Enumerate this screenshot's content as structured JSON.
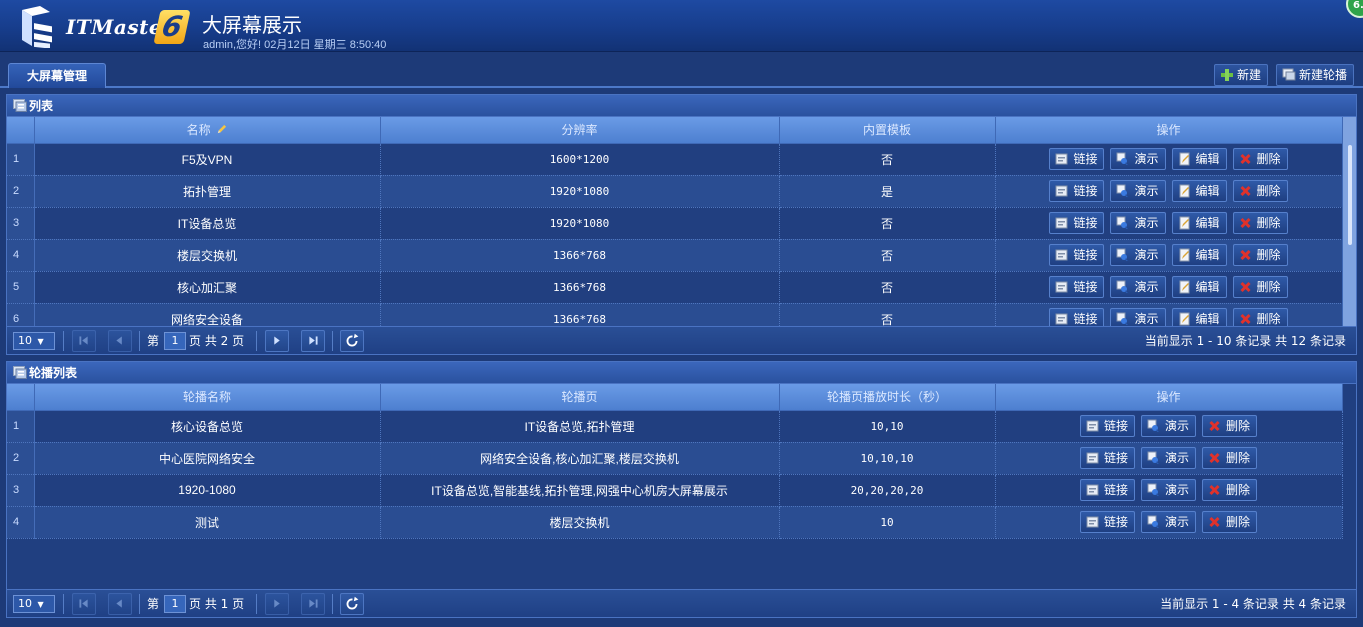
{
  "header": {
    "logo_text": "ITMaster",
    "logo_number": "6",
    "title": "大屏幕展示",
    "user_info": "admin,您好! 02月12日 星期三 8:50:40",
    "badge": "6."
  },
  "tabs": [
    {
      "label": "大屏幕管理"
    }
  ],
  "toolbar": {
    "new_label": "新建",
    "new_carousel_label": "新建轮播"
  },
  "list_panel": {
    "title": "列表",
    "columns": [
      "名称",
      "分辨率",
      "内置模板",
      "操作"
    ],
    "rows": [
      {
        "n": "1",
        "name": "F5及VPN",
        "res": "1600*1200",
        "builtin": "否"
      },
      {
        "n": "2",
        "name": "拓扑管理",
        "res": "1920*1080",
        "builtin": "是"
      },
      {
        "n": "3",
        "name": "IT设备总览",
        "res": "1920*1080",
        "builtin": "否"
      },
      {
        "n": "4",
        "name": "楼层交换机",
        "res": "1366*768",
        "builtin": "否"
      },
      {
        "n": "5",
        "name": "核心加汇聚",
        "res": "1366*768",
        "builtin": "否"
      },
      {
        "n": "6",
        "name": "网络安全设备",
        "res": "1366*768",
        "builtin": "否"
      }
    ],
    "actions": {
      "link": "链接",
      "demo": "演示",
      "edit": "编辑",
      "delete": "删除"
    },
    "pager": {
      "page_size": "10",
      "page_prefix": "第",
      "page": "1",
      "page_suffix": "页 共 2 页",
      "record_info": "当前显示 1 - 10 条记录 共 12 条记录"
    }
  },
  "carousel_panel": {
    "title": "轮播列表",
    "columns": [
      "轮播名称",
      "轮播页",
      "轮播页播放时长（秒）",
      "操作"
    ],
    "rows": [
      {
        "n": "1",
        "name": "核心设备总览",
        "pages": "IT设备总览,拓扑管理",
        "durations": "10,10"
      },
      {
        "n": "2",
        "name": "中心医院网络安全",
        "pages": "网络安全设备,核心加汇聚,楼层交换机",
        "durations": "10,10,10"
      },
      {
        "n": "3",
        "name": "1920-1080",
        "pages": "IT设备总览,智能基线,拓扑管理,网强中心机房大屏幕展示",
        "durations": "20,20,20,20"
      },
      {
        "n": "4",
        "name": "测试",
        "pages": "楼层交换机",
        "durations": "10"
      }
    ],
    "actions": {
      "link": "链接",
      "demo": "演示",
      "delete": "删除"
    },
    "pager": {
      "page_size": "10",
      "page_prefix": "第",
      "page": "1",
      "page_suffix": "页 共 1 页",
      "record_info": "当前显示 1 - 4 条记录 共 4 条记录"
    }
  },
  "icons": {
    "logo": "itmaster-logo-icon",
    "add": "plus-icon",
    "carousel": "slideshow-icon",
    "panel": "grid-list-icon",
    "link": "link-icon",
    "demo": "presentation-icon",
    "edit": "edit-icon",
    "delete": "close-x-icon",
    "pencil": "pencil-icon",
    "first": "first-page-icon",
    "prev": "prev-page-icon",
    "next": "next-page-icon",
    "last": "last-page-icon",
    "refresh": "refresh-icon"
  },
  "colors": {
    "background": "#1d3a78",
    "header": "#1e4aa2",
    "grid_header": "#6a9be6",
    "delete_red": "#e0322b",
    "add_green": "#6cc043"
  }
}
